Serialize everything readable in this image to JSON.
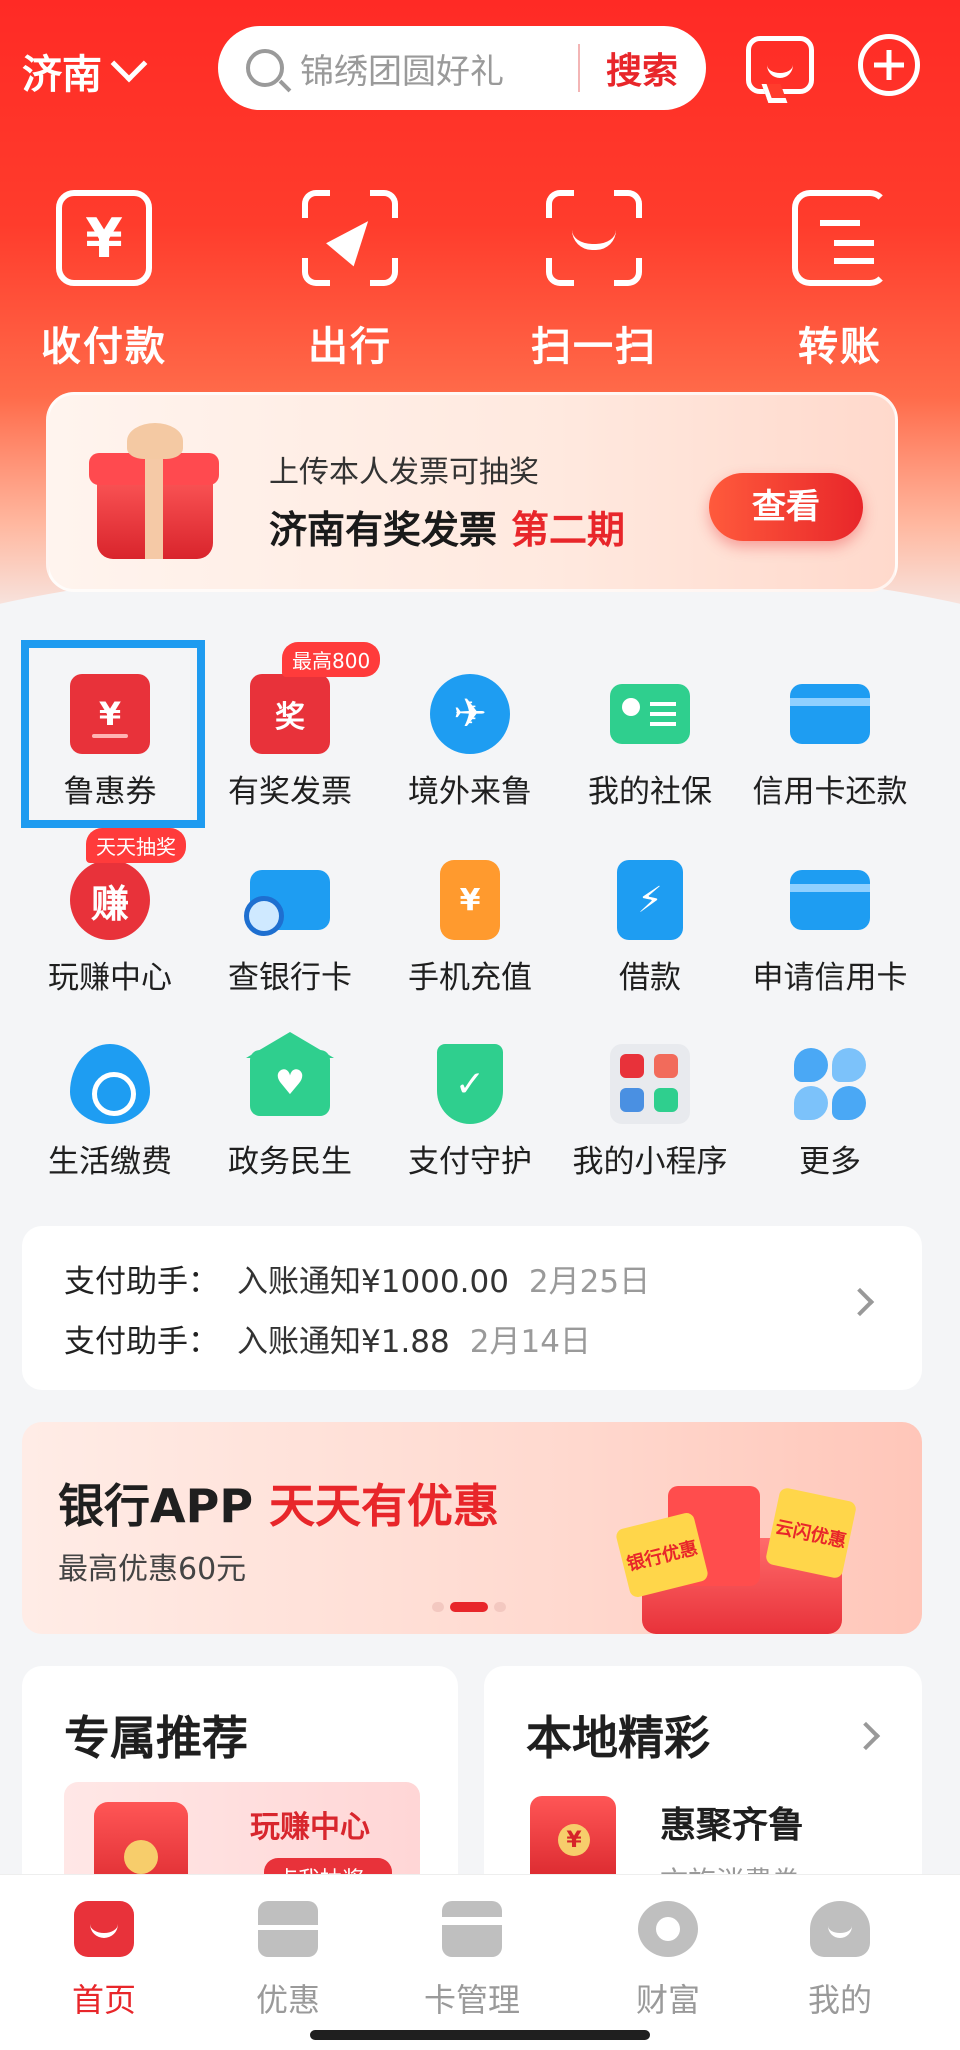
{
  "header": {
    "city": "济南",
    "search_placeholder": "锦绣团圆好礼",
    "search_button": "搜索"
  },
  "quick_actions": [
    {
      "label": "收付款",
      "icon": "yen-scan-icon"
    },
    {
      "label": "出行",
      "icon": "navigation-icon"
    },
    {
      "label": "扫一扫",
      "icon": "scan-icon"
    },
    {
      "label": "转账",
      "icon": "transfer-icon"
    }
  ],
  "promo": {
    "subtitle": "上传本人发票可抽奖",
    "title": "济南有奖发票",
    "title_highlight": "第二期",
    "button": "查看"
  },
  "grid": [
    {
      "label": "鲁惠券",
      "icon": "coupon-icon",
      "badge": ""
    },
    {
      "label": "有奖发票",
      "icon": "invoice-icon",
      "badge": "最高800"
    },
    {
      "label": "境外来鲁",
      "icon": "globe-plane-icon",
      "badge": ""
    },
    {
      "label": "我的社保",
      "icon": "social-security-icon",
      "badge": ""
    },
    {
      "label": "信用卡还款",
      "icon": "credit-card-repay-icon",
      "badge": ""
    },
    {
      "label": "玩赚中心",
      "icon": "earn-icon",
      "badge": "天天抽奖"
    },
    {
      "label": "查银行卡",
      "icon": "bank-card-search-icon",
      "badge": ""
    },
    {
      "label": "手机充值",
      "icon": "phone-recharge-icon",
      "badge": ""
    },
    {
      "label": "借款",
      "icon": "loan-icon",
      "badge": ""
    },
    {
      "label": "申请信用卡",
      "icon": "apply-credit-card-icon",
      "badge": ""
    },
    {
      "label": "生活缴费",
      "icon": "utility-payment-icon",
      "badge": ""
    },
    {
      "label": "政务民生",
      "icon": "government-icon",
      "badge": ""
    },
    {
      "label": "支付守护",
      "icon": "payment-shield-icon",
      "badge": ""
    },
    {
      "label": "我的小程序",
      "icon": "mini-program-icon",
      "badge": ""
    },
    {
      "label": "更多",
      "icon": "more-icon",
      "badge": ""
    }
  ],
  "notices": [
    {
      "who": "支付助手：",
      "msg": "入账通知¥1000.00",
      "date": "2月25日"
    },
    {
      "who": "支付助手：",
      "msg": "入账通知¥1.88",
      "date": "2月14日"
    }
  ],
  "banner": {
    "title": "银行APP",
    "title_highlight": "天天有优惠",
    "subtitle": "最高优惠60元",
    "ticket_left": "银行优惠",
    "ticket_right": "云闪优惠"
  },
  "cards": {
    "exclusive": {
      "title": "专属推荐",
      "tile_title": "玩赚中心",
      "tile_button": "点我抽奖 ›"
    },
    "local": {
      "title": "本地精彩",
      "item_title": "惠聚齐鲁",
      "item_sub": "文旅消费券"
    }
  },
  "tabs": [
    {
      "label": "首页",
      "active": true
    },
    {
      "label": "优惠",
      "active": false
    },
    {
      "label": "卡管理",
      "active": false
    },
    {
      "label": "财富",
      "active": false
    },
    {
      "label": "我的",
      "active": false
    }
  ],
  "colors": {
    "brand_red": "#e8262a",
    "accent_blue": "#1e9df2",
    "accent_green": "#2fcf8e"
  }
}
